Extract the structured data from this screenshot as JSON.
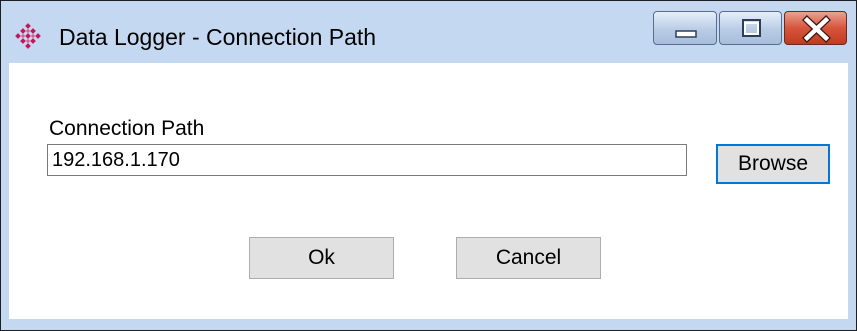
{
  "window": {
    "title": "Data Logger - Connection Path",
    "app_icon": "diamond-grid-icon",
    "caption_buttons": [
      "minimize-icon",
      "maximize-icon",
      "close-icon"
    ],
    "colors": {
      "frame": "#c4d9f1",
      "close_button": "#c13b21",
      "focus_border": "#0078d7",
      "app_icon": "#c2185b"
    }
  },
  "form": {
    "label": "Connection Path",
    "path_value": "192.168.1.170",
    "browse_label": "Browse",
    "ok_label": "Ok",
    "cancel_label": "Cancel"
  }
}
